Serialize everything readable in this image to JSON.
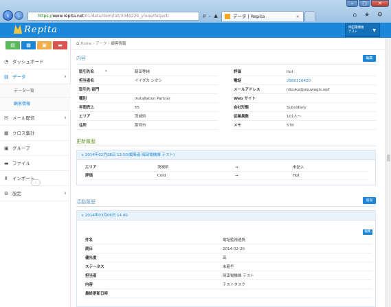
{
  "browser": {
    "url_scheme": "https://",
    "url_domain": "www.repita.net",
    "url_path": "/01/data/item/list/3346226_y(eoe/Skijecti",
    "url_controls": "ρ – ▲ ≡ ¢ ✕",
    "tab_title": "データ | Repita",
    "tab_close": "×",
    "window_buttons": [
      "–",
      "□",
      "✕"
    ],
    "toolbar_icons": "⌂ ★ ⚙"
  },
  "app": {
    "logo_text": "Repita",
    "user_menu_line1": "岡田電機維",
    "user_menu_line2": "テスト"
  },
  "sidebar": {
    "items": [
      {
        "label": "ダッシュボード",
        "icon": "dashboard-icon",
        "glyph": "◔"
      },
      {
        "label": "データ",
        "icon": "data-icon",
        "glyph": "▤"
      },
      {
        "label": "メール配信",
        "icon": "mail-icon",
        "glyph": "✉"
      },
      {
        "label": "クロス集計",
        "icon": "cross-tab-icon",
        "glyph": "▦"
      },
      {
        "label": "グループ",
        "icon": "group-icon",
        "glyph": "▣"
      },
      {
        "label": "ファイル",
        "icon": "folder-icon",
        "glyph": "▬"
      },
      {
        "label": "インポート",
        "icon": "import-icon",
        "glyph": "⬇"
      },
      {
        "label": "設定",
        "icon": "settings-icon",
        "glyph": "⚙"
      }
    ],
    "subitems": [
      "データ一覧",
      "顧客情報"
    ],
    "collapse_glyph": "‹"
  },
  "breadcrumb": {
    "home": "Home",
    "sep": "›",
    "mid": "データ",
    "current": "顧客情報"
  },
  "content": {
    "title": "内容",
    "edit_label": "編集",
    "left_rows": [
      {
        "k": "取引先名",
        "v": "藤田等純",
        "req": "*"
      },
      {
        "k": "担当者名",
        "v": "イイダカ シオン"
      },
      {
        "k": "取引先 部門",
        "v": ""
      },
      {
        "k": "種別",
        "v": "Installation Partner"
      },
      {
        "k": "年間売上",
        "v": "55"
      },
      {
        "k": "エリア",
        "v": "茨城県"
      },
      {
        "k": "住所",
        "v": "那珂市"
      }
    ],
    "right_rows": [
      {
        "k": "評価",
        "v": "Hot"
      },
      {
        "k": "電話",
        "v": "2980310420",
        "link": true
      },
      {
        "k": "メールアドレス",
        "v": "niizuka@oquwagis.wpf"
      },
      {
        "k": "Web サイト",
        "v": ""
      },
      {
        "k": "会社形態",
        "v": "Subsidiary"
      },
      {
        "k": "従業員数",
        "v": "101人～"
      },
      {
        "k": "メモ",
        "v": "578"
      }
    ]
  },
  "history": {
    "title": "更新履歴",
    "entry_header": "∨ 2014年02月28日 13:50(編集者 岡田電機維 テスト)",
    "rows": [
      {
        "field": "エリア",
        "from": "茨城県",
        "arrow": "→",
        "to": "未記入"
      },
      {
        "field": "評価",
        "from": "Cold",
        "arrow": "→",
        "to": "Hot"
      }
    ]
  },
  "activity": {
    "title": "活動履歴",
    "add_label": "追加",
    "entry_header": "∨ 2014年03月06日 14:40",
    "edit_label": "編集",
    "rows": [
      {
        "k": "件名",
        "v": "電話監視連携"
      },
      {
        "k": "期日",
        "v": "2014-02-26"
      },
      {
        "k": "優先度",
        "v": "高"
      },
      {
        "k": "ステータス",
        "v": "未着手"
      },
      {
        "k": "担当者",
        "v": "岡田電機維 テスト"
      },
      {
        "k": "内容",
        "v": "テストタスク"
      },
      {
        "k": "最終更新日時",
        "v": ""
      }
    ]
  },
  "colors": {
    "accent": "#1c87d8",
    "section_green": "#6b9a2f",
    "sidebar_icons": [
      "#5cb85c",
      "#1c87d8",
      "#f0ad4e",
      "#d9534f"
    ]
  }
}
